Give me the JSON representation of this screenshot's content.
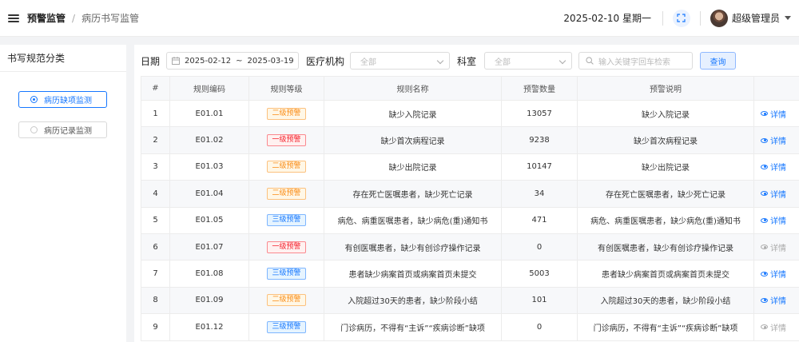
{
  "header": {
    "breadcrumb_main": "预警监管",
    "breadcrumb_separator": "/",
    "breadcrumb_sub": "病历书写监管",
    "date": "2025-02-10 星期一",
    "user_name": "超级管理员"
  },
  "sidebar": {
    "title": "书写规范分类",
    "items": [
      {
        "label": "病历缺项监测",
        "active": true
      },
      {
        "label": "病历记录监测",
        "active": false
      }
    ]
  },
  "filters": {
    "date_label": "日期",
    "date_start": "2025-02-12",
    "date_sep": "~",
    "date_end": "2025-03-19",
    "org_label": "医疗机构",
    "org_value": "全部",
    "dept_label": "科室",
    "dept_value": "全部",
    "search_placeholder": "输入关键字回车检索",
    "query_label": "查询"
  },
  "colors": {
    "accent": "#1677ff",
    "level2": "#fa8c16",
    "level1": "#f5222d",
    "level3": "#1677ff"
  },
  "table": {
    "headers": [
      "#",
      "规则编码",
      "规则等级",
      "规则名称",
      "预警数量",
      "预警说明",
      ""
    ],
    "rows": [
      {
        "idx": "1",
        "code": "E01.01",
        "level": "二级预警",
        "name": "缺少入院记录",
        "count": "13057",
        "desc": "缺少入院记录",
        "action": "详情",
        "enabled": true
      },
      {
        "idx": "2",
        "code": "E01.02",
        "level": "一级预警",
        "name": "缺少首次病程记录",
        "count": "9238",
        "desc": "缺少首次病程记录",
        "action": "详情",
        "enabled": true
      },
      {
        "idx": "3",
        "code": "E01.03",
        "level": "二级预警",
        "name": "缺少出院记录",
        "count": "10147",
        "desc": "缺少出院记录",
        "action": "详情",
        "enabled": true
      },
      {
        "idx": "4",
        "code": "E01.04",
        "level": "二级预警",
        "name": "存在死亡医嘱患者，缺少死亡记录",
        "count": "34",
        "desc": "存在死亡医嘱患者，缺少死亡记录",
        "action": "详情",
        "enabled": true
      },
      {
        "idx": "5",
        "code": "E01.05",
        "level": "三级预警",
        "name": "病危、病重医嘱患者，缺少病危(重)通知书",
        "count": "471",
        "desc": "病危、病重医嘱患者，缺少病危(重)通知书",
        "action": "详情",
        "enabled": true
      },
      {
        "idx": "6",
        "code": "E01.07",
        "level": "一级预警",
        "name": "有创医嘱患者，缺少有创诊疗操作记录",
        "count": "0",
        "desc": "有创医嘱患者，缺少有创诊疗操作记录",
        "action": "详情",
        "enabled": false
      },
      {
        "idx": "7",
        "code": "E01.08",
        "level": "三级预警",
        "name": "患者缺少病案首页或病案首页未提交",
        "count": "5003",
        "desc": "患者缺少病案首页或病案首页未提交",
        "action": "详情",
        "enabled": true
      },
      {
        "idx": "8",
        "code": "E01.09",
        "level": "二级预警",
        "name": "入院超过30天的患者，缺少阶段小结",
        "count": "101",
        "desc": "入院超过30天的患者，缺少阶段小结",
        "action": "详情",
        "enabled": true
      },
      {
        "idx": "9",
        "code": "E01.12",
        "level": "三级预警",
        "name": "门诊病历，不得有“主诉”“疾病诊断”缺项",
        "count": "0",
        "desc": "门诊病历，不得有“主诉”“疾病诊断”缺项",
        "action": "详情",
        "enabled": false
      }
    ]
  }
}
